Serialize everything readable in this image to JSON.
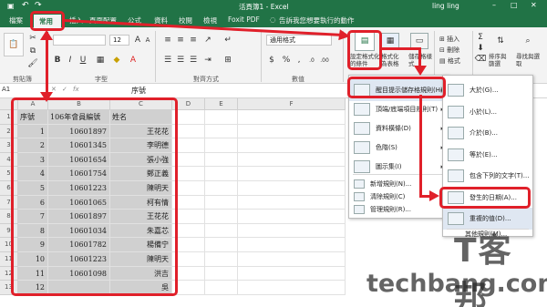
{
  "window": {
    "title": "活頁簿1 - Excel",
    "user": "ling ling"
  },
  "tabs": [
    "檔案",
    "常用",
    "插入",
    "頁面配置",
    "公式",
    "資料",
    "校閱",
    "檢視",
    "Foxit PDF"
  ],
  "tell_me": "告訴我您想要執行的動作",
  "ribbon": {
    "groups": [
      "剪貼簿",
      "字型",
      "對齊方式",
      "數值"
    ],
    "font_size": "12",
    "number_format": "通用格式",
    "cond_format_label": "設定格式化的條件",
    "format_table_label": "格式化為表格",
    "cell_styles_label": "儲存格樣式",
    "insert_label": "插入",
    "delete_label": "刪除",
    "format_label": "格式",
    "sort_filter_label": "排序與篩選",
    "find_select_label": "尋找與選取"
  },
  "name_box": "A1",
  "formula_value": "序號",
  "columns": [
    "A",
    "B",
    "C",
    "D",
    "E",
    "F"
  ],
  "table": {
    "headers": [
      "序號",
      "106年會員編號",
      "姓名"
    ],
    "rows": [
      [
        "1",
        "10601897",
        "王花花"
      ],
      [
        "2",
        "10601345",
        "李明德"
      ],
      [
        "3",
        "10601654",
        "張小強"
      ],
      [
        "4",
        "10601754",
        "鄭正義"
      ],
      [
        "5",
        "10601223",
        "陳明天"
      ],
      [
        "6",
        "10601065",
        "柯有情"
      ],
      [
        "7",
        "10601897",
        "王花花"
      ],
      [
        "8",
        "10601034",
        "朱嘉芯"
      ],
      [
        "9",
        "10601782",
        "楊備宁"
      ],
      [
        "10",
        "10601223",
        "陳明天"
      ],
      [
        "11",
        "10601098",
        "洪吉"
      ],
      [
        "12",
        "",
        "吳"
      ]
    ]
  },
  "cond_menu": [
    {
      "label": "醒目提示儲存格規則(H)",
      "arrow": "▸"
    },
    {
      "label": "頂端/底端項目規則(T)",
      "arrow": "▸"
    },
    {
      "label": "資料橫條(D)",
      "arrow": "▸"
    },
    {
      "label": "色階(S)",
      "arrow": "▸"
    },
    {
      "label": "圖示集(I)",
      "arrow": "▸"
    }
  ],
  "cond_menu_bottom": [
    "新增規則(N)...",
    "清除規則(C)",
    "管理規則(R)..."
  ],
  "sub_menu": [
    "大於(G)...",
    "小於(L)...",
    "介於(B)...",
    "等於(E)...",
    "包含下列的文字(T)...",
    "發生的日期(A)...",
    "重複的值(D)..."
  ],
  "sub_menu_more": "其他規則(M)...",
  "watermark": {
    "top": "T客邦",
    "bottom": "techbang.com"
  },
  "colors": {
    "excel_green": "#217346",
    "highlight_red": "#e0202a",
    "selected_gray": "#d0d0d0"
  }
}
